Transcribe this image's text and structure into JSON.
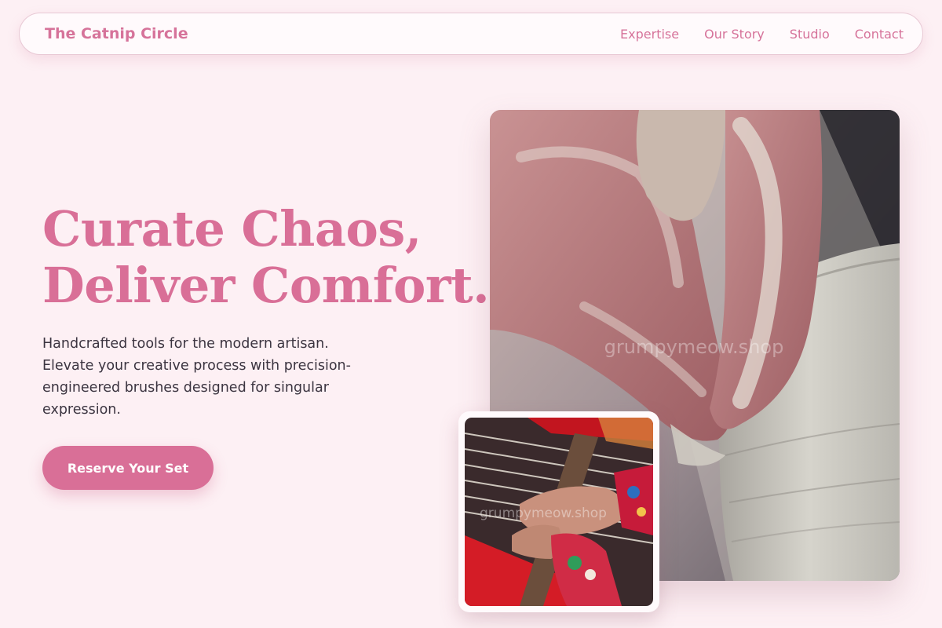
{
  "nav": {
    "brand": "The Catnip Circle",
    "links": [
      "Expertise",
      "Our Story",
      "Studio",
      "Contact"
    ]
  },
  "hero": {
    "title_line1": "Curate Chaos,",
    "title_line2": "Deliver Comfort.",
    "subtitle": "Handcrafted tools for the modern artisan. Elevate your creative process with precision-engineered brushes designed for singular expression.",
    "cta_label": "Reserve Your Set"
  },
  "images": {
    "main_watermark": "grumpymeow.shop",
    "small_watermark": "grumpymeow.shop"
  },
  "colors": {
    "accent": "#d96f97",
    "background": "#fdf0f4",
    "text": "#3b3440"
  }
}
